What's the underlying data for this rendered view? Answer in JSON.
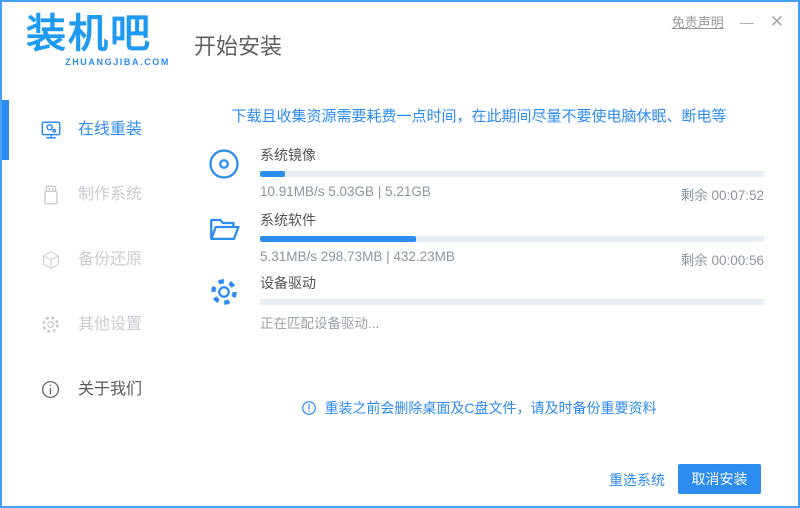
{
  "titlebar": {
    "logo_text": "装机吧",
    "logo_domain": "ZHUANGJIBA.COM",
    "disclaimer_link": "免责声明",
    "minimize_glyph": "—",
    "close_glyph": "✕"
  },
  "header": {
    "page_title": "开始安装"
  },
  "sidebar": {
    "items": [
      {
        "label": "在线重装",
        "icon": "online-reinstall-icon",
        "active": true
      },
      {
        "label": "制作系统",
        "icon": "usb-make-system-icon",
        "active": false
      },
      {
        "label": "备份还原",
        "icon": "backup-restore-icon",
        "active": false
      },
      {
        "label": "其他设置",
        "icon": "other-settings-gear-icon",
        "active": false
      },
      {
        "label": "关于我们",
        "icon": "about-info-icon",
        "active": false
      }
    ]
  },
  "main": {
    "warning_banner": "下载且收集资源需要耗费一点时间，在此期间尽量不要使电脑休眠、断电等",
    "tasks": [
      {
        "name": "系统镜像",
        "icon": "disc-icon",
        "progress_percent": 5,
        "stats": "10.91MB/s 5.03GB | 5.21GB",
        "remaining": "剩余 00:07:52"
      },
      {
        "name": "系统软件",
        "icon": "open-folder-icon",
        "progress_percent": 31,
        "stats": "5.31MB/s 298.73MB | 432.23MB",
        "remaining": "剩余 00:00:56"
      },
      {
        "name": "设备驱动",
        "icon": "driver-gear-icon",
        "progress_percent": 0,
        "status": "正在匹配设备驱动..."
      }
    ],
    "note": "重装之前会删除桌面及C盘文件，请及时备份重要资料"
  },
  "footer": {
    "reselect_button": "重选系统",
    "cancel_button": "取消安装"
  },
  "colors": {
    "accent": "#2D8CF0",
    "window_border": "#46A0F4",
    "progress_track": "#E9EEF5",
    "warning_text": "#2D8CF0",
    "muted_text": "#999999",
    "task_label_text": "#555555",
    "inactive_sidebar_text": "#C9CED4"
  }
}
